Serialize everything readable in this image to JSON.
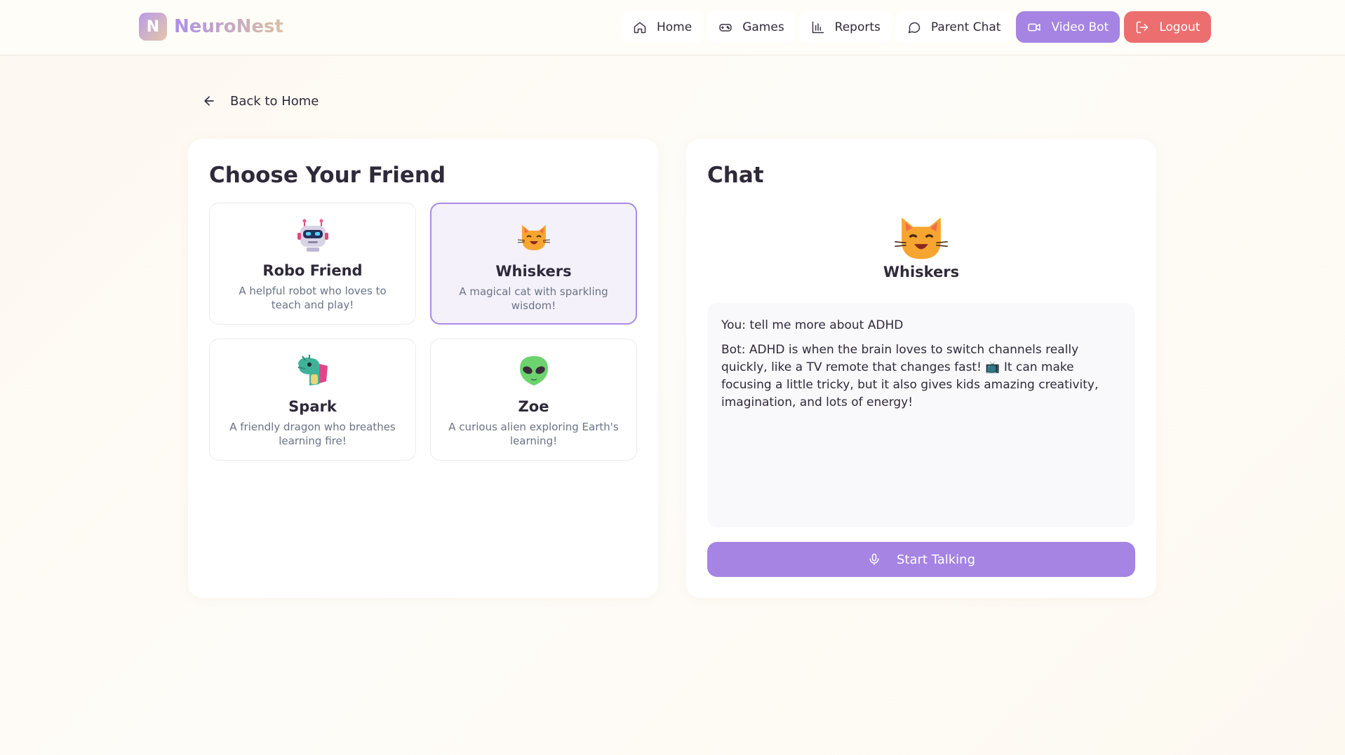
{
  "brand": {
    "logo_letter": "N",
    "name": "NeuroNest",
    "accent": "#a584e3"
  },
  "nav": {
    "home": {
      "label": "Home",
      "icon": "home-icon"
    },
    "games": {
      "label": "Games",
      "icon": "gamepad-icon"
    },
    "reports": {
      "label": "Reports",
      "icon": "bar-chart-icon"
    },
    "parent_chat": {
      "label": "Parent Chat",
      "icon": "chat-bubble-icon"
    },
    "video_bot": {
      "label": "Video Bot",
      "icon": "video-camera-icon",
      "color": "#a584e3"
    },
    "logout": {
      "label": "Logout",
      "icon": "logout-icon",
      "color": "#ec6e6e"
    }
  },
  "back": {
    "label": "Back to Home",
    "icon": "arrow-left-icon"
  },
  "friends_panel": {
    "title": "Choose Your Friend",
    "friends": [
      {
        "name": "Robo Friend",
        "description": "A helpful robot who loves to teach and play!",
        "icon": "robot-icon",
        "selected": false
      },
      {
        "name": "Whiskers",
        "description": "A magical cat with sparkling wisdom!",
        "icon": "cat-icon",
        "selected": true
      },
      {
        "name": "Spark",
        "description": "A friendly dragon who breathes learning fire!",
        "icon": "dragon-icon",
        "selected": false
      },
      {
        "name": "Zoe",
        "description": "A curious alien exploring Earth's learning!",
        "icon": "alien-icon",
        "selected": false
      }
    ]
  },
  "chat_panel": {
    "title": "Chat",
    "active_friend": "Whiskers",
    "messages": [
      {
        "text": "You: tell me more about ADHD"
      },
      {
        "text": "Bot: ADHD is when the brain loves to switch channels really quickly, like a TV remote that changes fast! 📺 It can make focusing a little tricky, but it also gives kids amazing creativity, imagination, and lots of energy!"
      }
    ],
    "talk_button": {
      "label": "Start Talking",
      "icon": "microphone-icon"
    }
  }
}
